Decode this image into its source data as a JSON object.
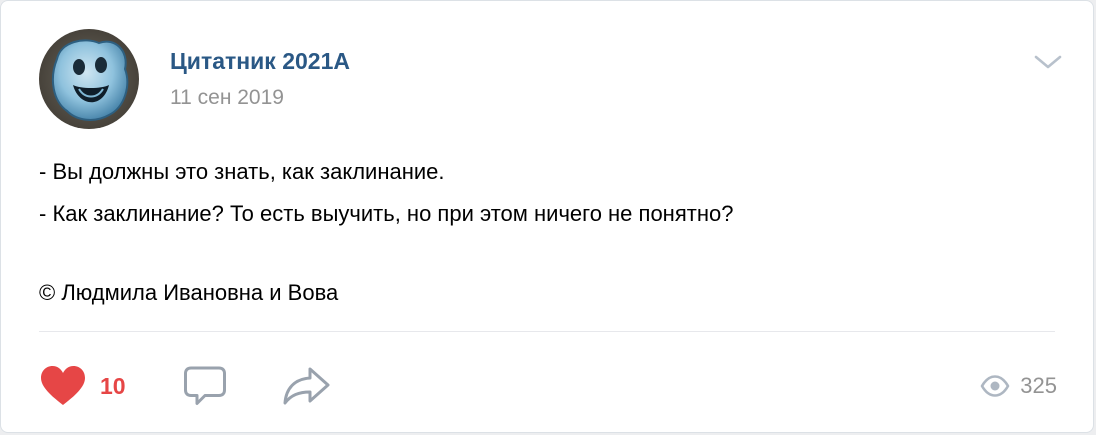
{
  "post": {
    "author": "Цитатник 2021А",
    "date": "11 сен 2019",
    "lines": [
      "- Вы должны это знать, как заклинание.",
      "- Как заклинание? То есть выучить, но при этом ничего не понятно?",
      "",
      "© Людмила Ивановна и Вова"
    ]
  },
  "actions": {
    "likes": "10",
    "views": "325"
  },
  "icons": {
    "avatar": "avatar-image",
    "menu": "chevron-down-icon",
    "like": "heart-icon",
    "comment": "comment-icon",
    "share": "share-icon",
    "views": "eye-icon"
  },
  "colors": {
    "author": "#2a5885",
    "like_active": "#e64646",
    "muted": "#939393",
    "icon": "#99a2ad"
  }
}
